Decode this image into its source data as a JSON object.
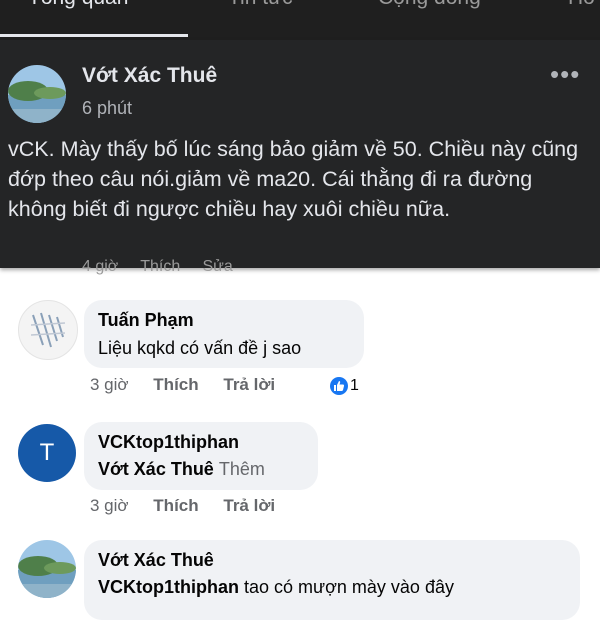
{
  "tabs": [
    {
      "label": "Tổng quan"
    },
    {
      "label": "Tin tức"
    },
    {
      "label": "Cộng đồng"
    },
    {
      "label": "Ho"
    }
  ],
  "post": {
    "author": "Vớt Xác Thuê",
    "time": "6 phút",
    "text": "vCK. Mày thấy bố lúc sáng bảo giảm về 50. Chiều này cũng đớp theo câu nói.giảm về ma20. Cái thằng đi ra đường không biết đi ngược chiều hay xuôi chiều nữa.",
    "more_icon": "more-horizontal-icon"
  },
  "ghost_actions": {
    "time": "4 giờ",
    "like": "Thích",
    "edit": "Sửa"
  },
  "comments": [
    {
      "author": "Tuấn Phạm",
      "text": "Liệu kqkd có vấn đề j sao",
      "time": "3 giờ",
      "like": "Thích",
      "reply": "Trả lời",
      "reaction_count": "1",
      "reaction_icon": "like-icon"
    },
    {
      "avatar_letter": "T",
      "author": "VCKtop1thiphan",
      "tag": "Vớt Xác Thuê",
      "more": "Thêm",
      "time": "3 giờ",
      "like": "Thích",
      "reply": "Trả lời"
    },
    {
      "author": "Vớt Xác Thuê",
      "tag": "VCKtop1thiphan",
      "text": "tao có mượn mày vào đây"
    }
  ],
  "colors": {
    "post_bg": "#242526",
    "reaction_blue": "#1877f2",
    "letter_avatar": "#1659a8"
  }
}
